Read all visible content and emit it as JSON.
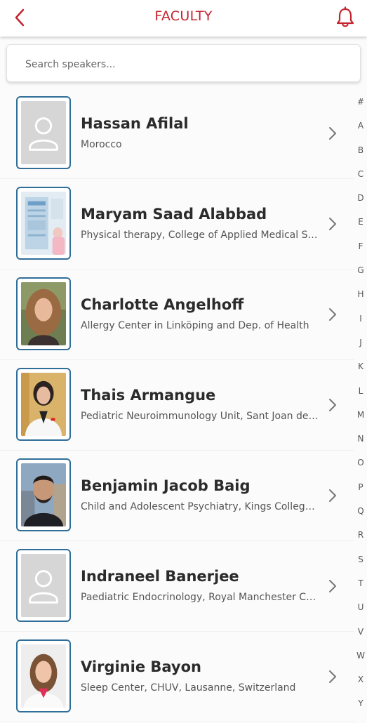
{
  "header": {
    "title": "FACULTY",
    "back_icon": "chevron-left-icon",
    "bell_icon": "bell-icon",
    "accent_color": "#c4232f"
  },
  "search": {
    "placeholder": "Search speakers..."
  },
  "speakers": [
    {
      "name": "Hassan Afilal",
      "affiliation": "Morocco",
      "photo": "placeholder"
    },
    {
      "name": "Maryam Saad Alabbad",
      "affiliation": "Physical therapy, College of Applied Medical Sciences",
      "photo": "photo"
    },
    {
      "name": "Charlotte Angelhoff",
      "affiliation": "Allergy Center in Linköping and Dep. of Health",
      "photo": "photo"
    },
    {
      "name": "Thais Armangue",
      "affiliation": "Pediatric Neuroimmunology Unit, Sant Joan de Déu",
      "photo": "photo"
    },
    {
      "name": "Benjamin Jacob Baig",
      "affiliation": "Child and Adolescent Psychiatry, Kings College London",
      "photo": "photo"
    },
    {
      "name": "Indraneel Banerjee",
      "affiliation": "Paediatric Endocrinology, Royal Manchester Children's Hospital",
      "photo": "placeholder"
    },
    {
      "name": "Virginie Bayon",
      "affiliation": "Sleep Center, CHUV, Lausanne, Switzerland",
      "photo": "photo"
    }
  ],
  "alphabet_index": [
    "#",
    "A",
    "B",
    "C",
    "D",
    "E",
    "F",
    "G",
    "H",
    "I",
    "J",
    "K",
    "L",
    "M",
    "N",
    "O",
    "P",
    "Q",
    "R",
    "S",
    "T",
    "U",
    "V",
    "W",
    "X",
    "Y"
  ],
  "colors": {
    "avatar_border": "#2f6e99",
    "placeholder_bg": "#d6d6d6"
  }
}
